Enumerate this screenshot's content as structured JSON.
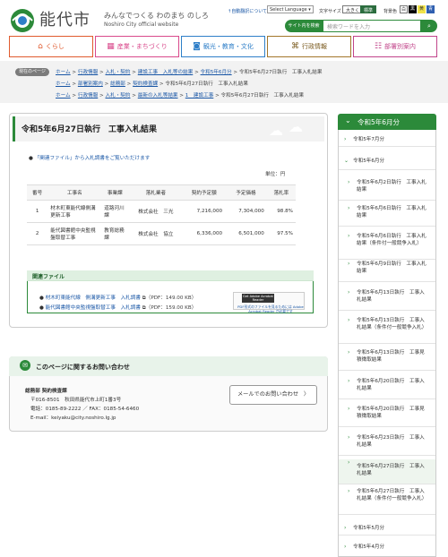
{
  "header": {
    "city_name": "能代市",
    "tagline": "みんなでつくる わのまち のしろ",
    "english_name": "Noshiro City official website",
    "auto_translate": "↑自動翻訳について",
    "language_select": "Select Language",
    "text_size_label": "文字サイズ",
    "text_size_large": "大きく",
    "text_size_standard": "標準",
    "bg_color_label": "背景色",
    "bg_white": "白",
    "bg_black": "黒",
    "bg_yellow": "黄",
    "bg_blue": "青",
    "search_label": "サイト内を検索",
    "search_placeholder": "検索ワードを入力",
    "search_button_icon": "search-icon"
  },
  "global_nav": [
    {
      "label": "くらし",
      "icon": "house-icon",
      "color": "#e05a2e"
    },
    {
      "label": "産業・まちづくり",
      "icon": "store-icon",
      "color": "#d94a8c"
    },
    {
      "label": "観光・教育・文化",
      "icon": "camera-icon",
      "color": "#2f7fc8"
    },
    {
      "label": "行政情報",
      "icon": "building-icon",
      "color": "#a3762a"
    },
    {
      "label": "部署別案内",
      "icon": "org-icon",
      "color": "#c1448a"
    }
  ],
  "breadcrumbs": {
    "label": "現在のページ",
    "trail1": [
      "ホーム",
      "行政情報",
      "入札・契約",
      "建設工事　入札等の結果",
      "令和5年6月分",
      "令和5年6月27日執行　工事入札結果"
    ],
    "trail2": [
      "ホーム",
      "部署別案内",
      "総務部",
      "契約検査課",
      "令和5年6月27日執行　工事入札結果"
    ],
    "trail3": [
      "ホーム",
      "行政情報",
      "入札・契約",
      "最新の入札等結果",
      "1　建設工事",
      "令和5年6月27日執行　工事入札結果"
    ]
  },
  "main": {
    "title": "令和5年6月27日執行　工事入札結果",
    "intro_link": "「関連ファイル」から入札調書をご覧いただけます",
    "unit": "単位：円",
    "table": {
      "headers": [
        "番号",
        "工事名",
        "事業課",
        "落札業者",
        "契約予定額",
        "予定価格",
        "落札率"
      ],
      "rows": [
        {
          "no": "1",
          "name": "材木町東能代線側溝更新工事",
          "dept": "道路河川課",
          "winner": "株式会社　三光",
          "contract": "7,216,000",
          "estimate": "7,304,000",
          "rate": "98.8%"
        },
        {
          "no": "2",
          "name": "能代図書館中央監視盤取替工事",
          "dept": "教育総務課",
          "winner": "株式会社　協立",
          "contract": "6,336,000",
          "estimate": "6,501,000",
          "rate": "97.5%"
        }
      ]
    },
    "related": {
      "title": "関連ファイル",
      "files": [
        {
          "name": "材木町東能代線　側溝更新工事　入札調書",
          "meta": "（PDF：149.00 KB）"
        },
        {
          "name": "能代図書館中央監視盤取替工事　入札調書",
          "meta": "（PDF：159.00 KB）"
        }
      ],
      "adobe_badge": "Get Adobe Acrobat Reader",
      "adobe_note": "PDF形式のファイルを見るためには Adobe Acrobat Reader が必要です"
    }
  },
  "contact": {
    "title": "このページに関するお問い合わせ",
    "dept": "総務部 契約検査課",
    "address": "〒016-8501　秋田県能代市上町1番3号",
    "phone": "電話：0185-89-2222 ／ FAX：0185-54-6460",
    "email": "E-mail：keiyaku@city.noshiro.lg.jp",
    "mail_button": "メールでのお問い合わせ",
    "mail_button_arrow": "〉"
  },
  "sidebar": {
    "title": "令和5年6月分",
    "items": [
      {
        "label": "令和5年7月分",
        "level": 1
      },
      {
        "label": "令和5年6月分",
        "level": 1
      },
      {
        "label": "令和5年6月2日執行　工事入札結果",
        "level": 2
      },
      {
        "label": "令和5年6月6日執行　工事入札結果",
        "level": 2
      },
      {
        "label": "令和5年6月6日執行　工事入札結果（条件付一般競争入札）",
        "level": 2
      },
      {
        "label": "令和5年6月9日執行　工事入札結果",
        "level": 2
      },
      {
        "label": "令和5年6月13日執行　工事入札結果",
        "level": 2
      },
      {
        "label": "令和5年6月13日執行　工事入札結果（条件付一般競争入札）",
        "level": 2
      },
      {
        "label": "令和5年6月13日執行　工事見積徴取結果",
        "level": 2
      },
      {
        "label": "令和5年6月20日執行　工事入札結果",
        "level": 2
      },
      {
        "label": "令和5年6月20日執行　工事見積徴取結果",
        "level": 2
      },
      {
        "label": "令和5年6月23日執行　工事入札結果",
        "level": 2
      },
      {
        "label": "令和5年6月27日執行　工事入札結果",
        "level": 2,
        "current": true
      },
      {
        "label": "令和5年6月27日執行　工事入札結果（条件付一般競争入札）",
        "level": 2
      },
      {
        "label": "令和5年5月分",
        "level": 1
      },
      {
        "label": "令和5年4月分",
        "level": 1
      }
    ]
  }
}
